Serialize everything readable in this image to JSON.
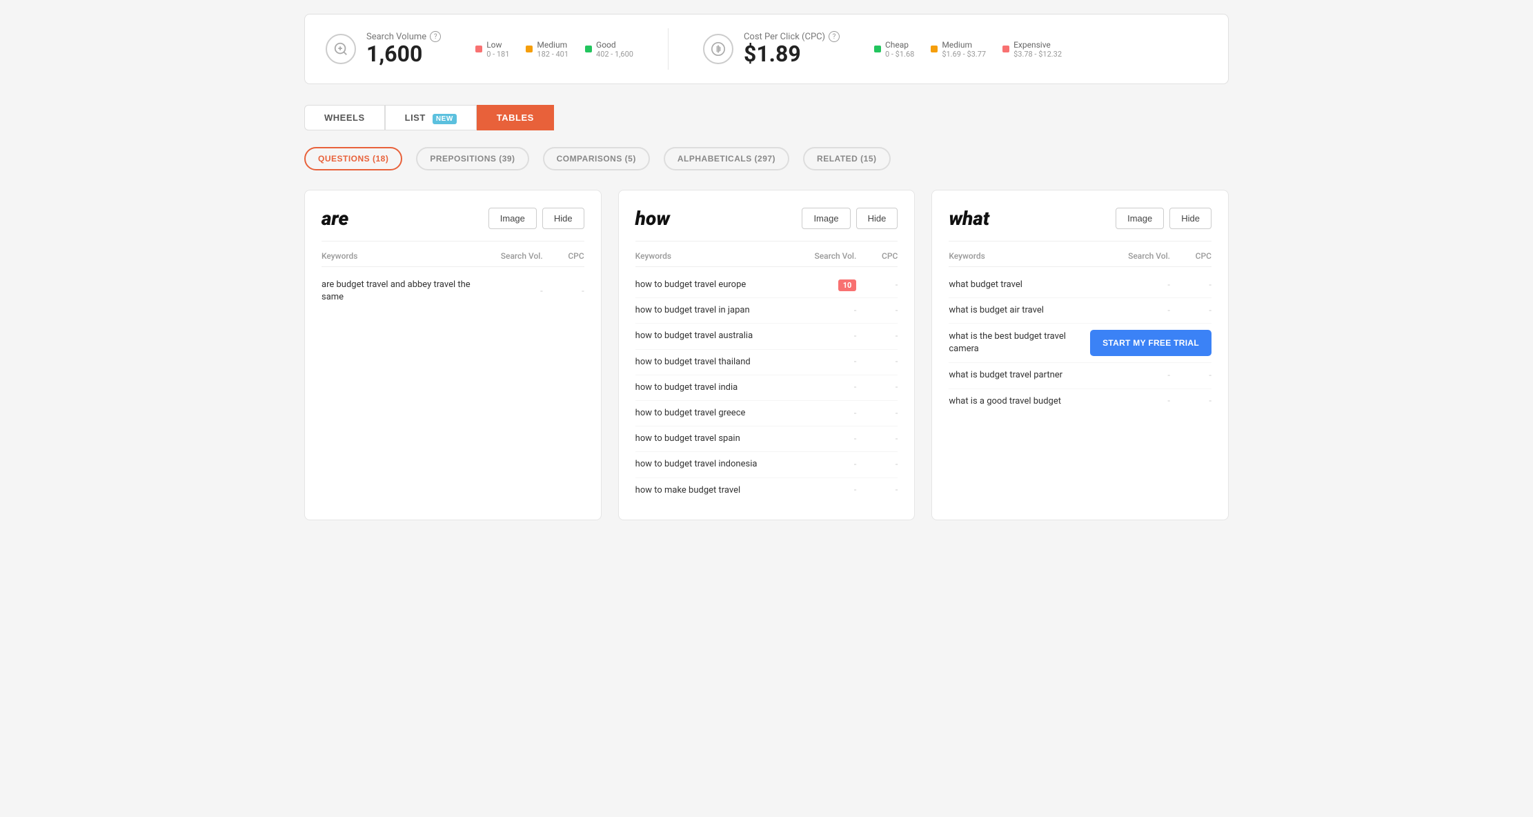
{
  "stats": {
    "search_volume": {
      "label": "Search Volume",
      "value": "1,600",
      "legend": [
        {
          "color": "#f87171",
          "label": "Low",
          "range": "0 - 181"
        },
        {
          "color": "#f59e0b",
          "label": "Medium",
          "range": "182 - 401"
        },
        {
          "color": "#22c55e",
          "label": "Good",
          "range": "402 - 1,600"
        }
      ]
    },
    "cpc": {
      "label": "Cost Per Click (CPC)",
      "value": "$1.89",
      "legend": [
        {
          "color": "#22c55e",
          "label": "Cheap",
          "range": "0 - $1.68"
        },
        {
          "color": "#f59e0b",
          "label": "Medium",
          "range": "$1.69 - $3.77"
        },
        {
          "color": "#f87171",
          "label": "Expensive",
          "range": "$3.78 - $12.32"
        }
      ]
    }
  },
  "tabs": [
    {
      "id": "wheels",
      "label": "WHEELS",
      "active": false,
      "badge": null
    },
    {
      "id": "list",
      "label": "LIST",
      "active": false,
      "badge": "NEW"
    },
    {
      "id": "tables",
      "label": "TABLES",
      "active": true,
      "badge": null
    }
  ],
  "categories": [
    {
      "id": "questions",
      "label": "QUESTIONS (18)",
      "active": true
    },
    {
      "id": "prepositions",
      "label": "PREPOSITIONS (39)",
      "active": false
    },
    {
      "id": "comparisons",
      "label": "COMPARISONS (5)",
      "active": false
    },
    {
      "id": "alphabeticals",
      "label": "ALPHABETICALS (297)",
      "active": false
    },
    {
      "id": "related",
      "label": "RELATED (15)",
      "active": false
    }
  ],
  "cards": [
    {
      "id": "are",
      "title": "are",
      "image_btn": "Image",
      "hide_btn": "Hide",
      "col_keyword": "Keywords",
      "col_vol": "Search Vol.",
      "col_cpc": "CPC",
      "rows": [
        {
          "keyword": "are budget travel and abbey travel the same",
          "vol": "-",
          "cpc": "-",
          "vol_highlight": false
        }
      ]
    },
    {
      "id": "how",
      "title": "how",
      "image_btn": "Image",
      "hide_btn": "Hide",
      "col_keyword": "Keywords",
      "col_vol": "Search Vol.",
      "col_cpc": "CPC",
      "rows": [
        {
          "keyword": "how to budget travel europe",
          "vol": "10",
          "cpc": "-",
          "vol_highlight": true
        },
        {
          "keyword": "how to budget travel in japan",
          "vol": "-",
          "cpc": "-",
          "vol_highlight": false
        },
        {
          "keyword": "how to budget travel australia",
          "vol": "-",
          "cpc": "-",
          "vol_highlight": false
        },
        {
          "keyword": "how to budget travel thailand",
          "vol": "-",
          "cpc": "-",
          "vol_highlight": false
        },
        {
          "keyword": "how to budget travel india",
          "vol": "-",
          "cpc": "-",
          "vol_highlight": false
        },
        {
          "keyword": "how to budget travel greece",
          "vol": "-",
          "cpc": "-",
          "vol_highlight": false
        },
        {
          "keyword": "how to budget travel spain",
          "vol": "-",
          "cpc": "-",
          "vol_highlight": false
        },
        {
          "keyword": "how to budget travel indonesia",
          "vol": "-",
          "cpc": "-",
          "vol_highlight": false
        },
        {
          "keyword": "how to make budget travel",
          "vol": "-",
          "cpc": "-",
          "vol_highlight": false
        }
      ]
    },
    {
      "id": "what",
      "title": "what",
      "image_btn": "Image",
      "hide_btn": "Hide",
      "col_keyword": "Keywords",
      "col_vol": "Search Vol.",
      "col_cpc": "CPC",
      "rows": [
        {
          "keyword": "what budget travel",
          "vol": "-",
          "cpc": "-",
          "vol_highlight": false,
          "cta": false
        },
        {
          "keyword": "what is budget air travel",
          "vol": "-",
          "cpc": "-",
          "vol_highlight": false,
          "cta": false
        },
        {
          "keyword": "what is the best budget travel camera",
          "vol": "-",
          "cpc": "-",
          "vol_highlight": false,
          "cta": true
        },
        {
          "keyword": "what is budget travel partner",
          "vol": "-",
          "cpc": "-",
          "vol_highlight": false,
          "cta": false
        },
        {
          "keyword": "what is a good travel budget",
          "vol": "-",
          "cpc": "-",
          "vol_highlight": false,
          "cta": false
        }
      ],
      "cta_label": "START MY FREE TRIAL"
    }
  ]
}
